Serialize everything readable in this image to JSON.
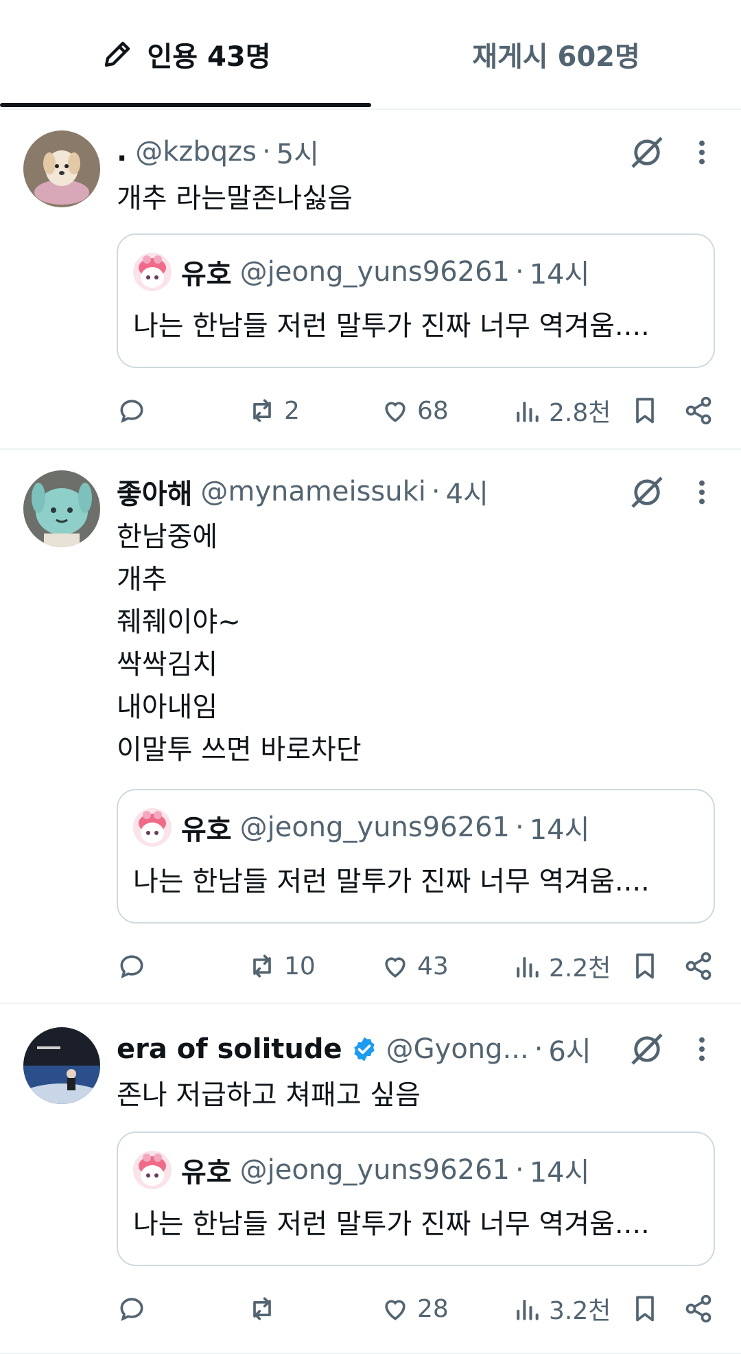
{
  "tabs": {
    "quotes": "인용 43명",
    "reposts": "재게시 602명"
  },
  "posts": [
    {
      "name": ".",
      "handle": "@kzbqzs",
      "time": "5시",
      "verified": false,
      "text": "개추 라는말존나싫음",
      "quote": {
        "name": "유호",
        "handle": "@jeong_yuns96261",
        "time": "14시",
        "text": "나는 한남들 저런 말투가 진짜 너무 역겨움...."
      },
      "replies": "",
      "reposts": "2",
      "likes": "68",
      "views": "2.8천"
    },
    {
      "name": "좋아해",
      "handle": "@mynameissuki",
      "time": "4시",
      "verified": false,
      "text": "한남중에\n개추\n줴줴이야~\n싹싹김치\n내아내임\n이말투 쓰면 바로차단",
      "quote": {
        "name": "유호",
        "handle": "@jeong_yuns96261",
        "time": "14시",
        "text": "나는 한남들 저런 말투가 진짜 너무 역겨움...."
      },
      "replies": "",
      "reposts": "10",
      "likes": "43",
      "views": "2.2천"
    },
    {
      "name": "era of solitude",
      "handle": "@Gyong...",
      "time": "6시",
      "verified": true,
      "text": "존나 저급하고 쳐패고 싶음",
      "quote": {
        "name": "유호",
        "handle": "@jeong_yuns96261",
        "time": "14시",
        "text": "나는 한남들 저런 말투가 진짜 너무 역겨움...."
      },
      "replies": "",
      "reposts": "",
      "likes": "28",
      "views": "3.2천"
    }
  ],
  "colors": {
    "text": "#0f1419",
    "muted": "#536471",
    "border": "#cfd9de",
    "verified": "#1d9bf0"
  }
}
